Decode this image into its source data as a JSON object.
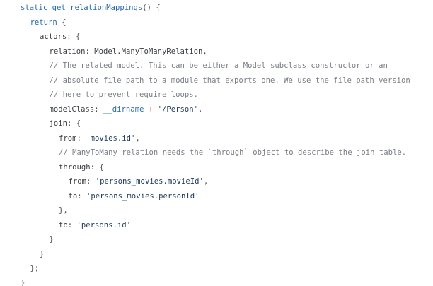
{
  "editor": {
    "lines": [
      {
        "indent": 0,
        "tokens": [
          {
            "t": "kw",
            "v": "static get "
          },
          {
            "t": "fn",
            "v": "relationMappings"
          },
          {
            "t": "punct",
            "v": "() {"
          }
        ]
      },
      {
        "indent": 1,
        "tokens": [
          {
            "t": "kw",
            "v": "return"
          },
          {
            "t": "punct",
            "v": " {"
          }
        ]
      },
      {
        "indent": 2,
        "tokens": [
          {
            "t": "plain",
            "v": "actors"
          },
          {
            "t": "punct",
            "v": ": {"
          }
        ]
      },
      {
        "indent": 3,
        "tokens": [
          {
            "t": "plain",
            "v": "relation"
          },
          {
            "t": "punct",
            "v": ": "
          },
          {
            "t": "plain",
            "v": "Model.ManyToManyRelation"
          },
          {
            "t": "punct",
            "v": ","
          }
        ]
      },
      {
        "indent": 3,
        "tokens": [
          {
            "t": "comment",
            "v": "// The related model. This can be either a Model subclass constructor or an"
          }
        ]
      },
      {
        "indent": 3,
        "tokens": [
          {
            "t": "comment",
            "v": "// absolute file path to a module that exports one. We use the file path version"
          }
        ]
      },
      {
        "indent": 3,
        "tokens": [
          {
            "t": "comment",
            "v": "// here to prevent require loops."
          }
        ]
      },
      {
        "indent": 3,
        "tokens": [
          {
            "t": "plain",
            "v": "modelClass"
          },
          {
            "t": "punct",
            "v": ": "
          },
          {
            "t": "var",
            "v": "__dirname"
          },
          {
            "t": "op",
            "v": " + "
          },
          {
            "t": "str",
            "v": "'/Person'"
          },
          {
            "t": "punct",
            "v": ","
          }
        ]
      },
      {
        "indent": 3,
        "tokens": [
          {
            "t": "plain",
            "v": "join"
          },
          {
            "t": "punct",
            "v": ": {"
          }
        ]
      },
      {
        "indent": 4,
        "tokens": [
          {
            "t": "plain",
            "v": "from"
          },
          {
            "t": "punct",
            "v": ": "
          },
          {
            "t": "str",
            "v": "'movies.id'"
          },
          {
            "t": "punct",
            "v": ","
          }
        ]
      },
      {
        "indent": 4,
        "tokens": [
          {
            "t": "comment",
            "v": "// ManyToMany relation needs the `through` object to describe the join table."
          }
        ]
      },
      {
        "indent": 4,
        "tokens": [
          {
            "t": "plain",
            "v": "through"
          },
          {
            "t": "punct",
            "v": ": {"
          }
        ]
      },
      {
        "indent": 5,
        "tokens": [
          {
            "t": "plain",
            "v": "from"
          },
          {
            "t": "punct",
            "v": ": "
          },
          {
            "t": "str",
            "v": "'persons_movies.movieId'"
          },
          {
            "t": "punct",
            "v": ","
          }
        ]
      },
      {
        "indent": 5,
        "tokens": [
          {
            "t": "plain",
            "v": "to"
          },
          {
            "t": "punct",
            "v": ": "
          },
          {
            "t": "str",
            "v": "'persons_movies.personId'"
          }
        ]
      },
      {
        "indent": 4,
        "tokens": [
          {
            "t": "punct",
            "v": "},"
          }
        ]
      },
      {
        "indent": 4,
        "tokens": [
          {
            "t": "plain",
            "v": "to"
          },
          {
            "t": "punct",
            "v": ": "
          },
          {
            "t": "str",
            "v": "'persons.id'"
          }
        ]
      },
      {
        "indent": 3,
        "tokens": [
          {
            "t": "punct",
            "v": "}"
          }
        ]
      },
      {
        "indent": 2,
        "tokens": [
          {
            "t": "punct",
            "v": "}"
          }
        ]
      },
      {
        "indent": 1,
        "tokens": [
          {
            "t": "punct",
            "v": "};"
          }
        ]
      },
      {
        "indent": 0,
        "tokens": [
          {
            "t": "punct",
            "v": "}"
          }
        ]
      }
    ]
  },
  "colors": {
    "keyword": "#2b6aa8",
    "comment": "#7a7f86",
    "string": "#1f3a5a",
    "operator": "#c0392b",
    "background": "#ffffff"
  }
}
